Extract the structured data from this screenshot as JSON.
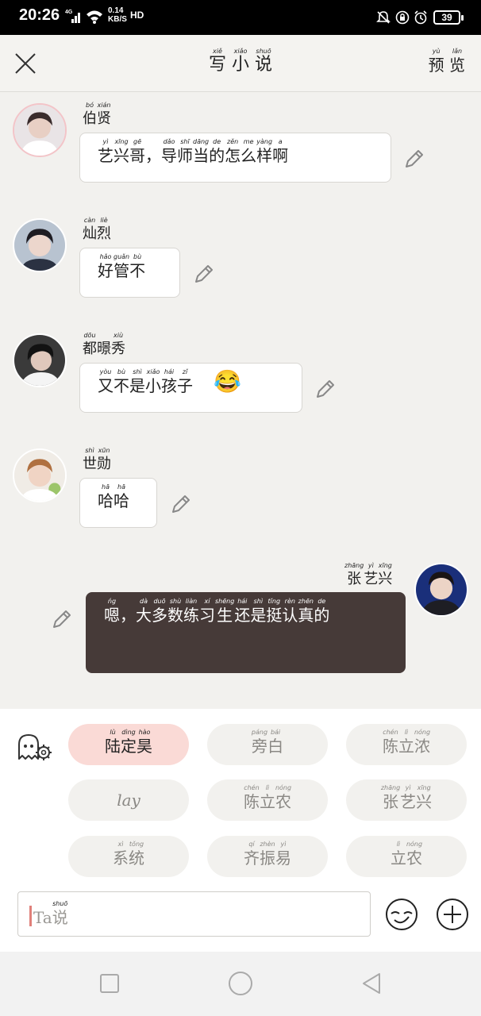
{
  "status_bar": {
    "time": "20:26",
    "network": "4G",
    "speed_value": "0.14",
    "speed_unit": "KB/S",
    "hd": "HD",
    "battery": "39"
  },
  "header": {
    "title": [
      {
        "py": "xiě",
        "hz": "写"
      },
      {
        "py": "xiǎo",
        "hz": "小"
      },
      {
        "py": "shuō",
        "hz": "说"
      }
    ],
    "preview": [
      {
        "py": "yù",
        "hz": "预"
      },
      {
        "py": "lǎn",
        "hz": "览"
      }
    ]
  },
  "messages": [
    {
      "name": [
        {
          "py": "bó",
          "hz": "伯"
        },
        {
          "py": "xián",
          "hz": "贤"
        }
      ],
      "text": [
        {
          "py": "yì",
          "hz": "艺"
        },
        {
          "py": "xīng",
          "hz": "兴"
        },
        {
          "py": "gē",
          "hz": "哥"
        },
        {
          "py": "",
          "hz": "，"
        },
        {
          "py": "dǎo",
          "hz": "导"
        },
        {
          "py": "shī",
          "hz": "师"
        },
        {
          "py": "dāng",
          "hz": "当"
        },
        {
          "py": "de",
          "hz": "的"
        },
        {
          "py": "zěn",
          "hz": "怎"
        },
        {
          "py": "me",
          "hz": "么"
        },
        {
          "py": "yàng",
          "hz": "样"
        },
        {
          "py": "a",
          "hz": "啊"
        }
      ],
      "emoji": ""
    },
    {
      "name": [
        {
          "py": "càn",
          "hz": "灿"
        },
        {
          "py": "liè",
          "hz": "烈"
        }
      ],
      "text": [
        {
          "py": "hǎo",
          "hz": "好"
        },
        {
          "py": "guǎn",
          "hz": "管"
        },
        {
          "py": "bù",
          "hz": "不"
        }
      ],
      "emoji": ""
    },
    {
      "name": [
        {
          "py": "dōu",
          "hz": "都"
        },
        {
          "py": "",
          "hz": "暻"
        },
        {
          "py": "xiù",
          "hz": "秀"
        }
      ],
      "text": [
        {
          "py": "yòu",
          "hz": "又"
        },
        {
          "py": "bù",
          "hz": "不"
        },
        {
          "py": "shì",
          "hz": "是"
        },
        {
          "py": "xiǎo",
          "hz": "小"
        },
        {
          "py": "hái",
          "hz": "孩"
        },
        {
          "py": "zǐ",
          "hz": "子"
        }
      ],
      "emoji": "😂"
    },
    {
      "name": [
        {
          "py": "shì",
          "hz": "世"
        },
        {
          "py": "xūn",
          "hz": "勋"
        }
      ],
      "text": [
        {
          "py": "hā",
          "hz": "哈"
        },
        {
          "py": "hā",
          "hz": "哈"
        }
      ],
      "emoji": ""
    },
    {
      "name": [
        {
          "py": "zhāng",
          "hz": "张"
        },
        {
          "py": "yì",
          "hz": "艺"
        },
        {
          "py": "xīng",
          "hz": "兴"
        }
      ],
      "text": [
        {
          "py": "ńg",
          "hz": "嗯"
        },
        {
          "py": "",
          "hz": "，"
        },
        {
          "py": "dà",
          "hz": "大"
        },
        {
          "py": "duō",
          "hz": "多"
        },
        {
          "py": "shù",
          "hz": "数"
        },
        {
          "py": "liàn",
          "hz": "练"
        },
        {
          "py": "xí",
          "hz": "习"
        },
        {
          "py": "shēng",
          "hz": "生"
        },
        {
          "py": "hái",
          "hz": "还"
        },
        {
          "py": "shì",
          "hz": "是"
        },
        {
          "py": "tǐng",
          "hz": "挺"
        },
        {
          "py": "rèn",
          "hz": "认"
        },
        {
          "py": "zhēn",
          "hz": "真"
        },
        {
          "py": "de",
          "hz": "的"
        }
      ],
      "emoji": ""
    }
  ],
  "characters": [
    [
      {
        "py": "lù",
        "hz": "陆"
      },
      {
        "py": "dìng",
        "hz": "定"
      },
      {
        "py": "hào",
        "hz": "昊"
      }
    ],
    [
      {
        "py": "páng",
        "hz": "旁"
      },
      {
        "py": "bái",
        "hz": "白"
      }
    ],
    [
      {
        "py": "chén",
        "hz": "陈"
      },
      {
        "py": "lì",
        "hz": "立"
      },
      {
        "py": "nóng",
        "hz": "浓"
      }
    ],
    [
      {
        "py": "",
        "hz": "lay"
      }
    ],
    [
      {
        "py": "chén",
        "hz": "陈"
      },
      {
        "py": "lì",
        "hz": "立"
      },
      {
        "py": "nóng",
        "hz": "农"
      }
    ],
    [
      {
        "py": "zhāng",
        "hz": "张"
      },
      {
        "py": "yì",
        "hz": "艺"
      },
      {
        "py": "xīng",
        "hz": "兴"
      }
    ],
    [
      {
        "py": "xì",
        "hz": "系"
      },
      {
        "py": "tǒng",
        "hz": "统"
      }
    ],
    [
      {
        "py": "qí",
        "hz": "齐"
      },
      {
        "py": "zhèn",
        "hz": "振"
      },
      {
        "py": "yì",
        "hz": "易"
      }
    ],
    [
      {
        "py": "lì",
        "hz": "立"
      },
      {
        "py": "nóng",
        "hz": "农"
      }
    ]
  ],
  "input": {
    "placeholder": [
      {
        "py": "",
        "hz": "Ta"
      },
      {
        "py": "shuō",
        "hz": "说"
      }
    ]
  },
  "colors": {
    "background": "#f2f1ee",
    "dark_bubble": "#463a38",
    "active_chip": "#fadad6",
    "avatar_ring": "#f3c4c8"
  }
}
